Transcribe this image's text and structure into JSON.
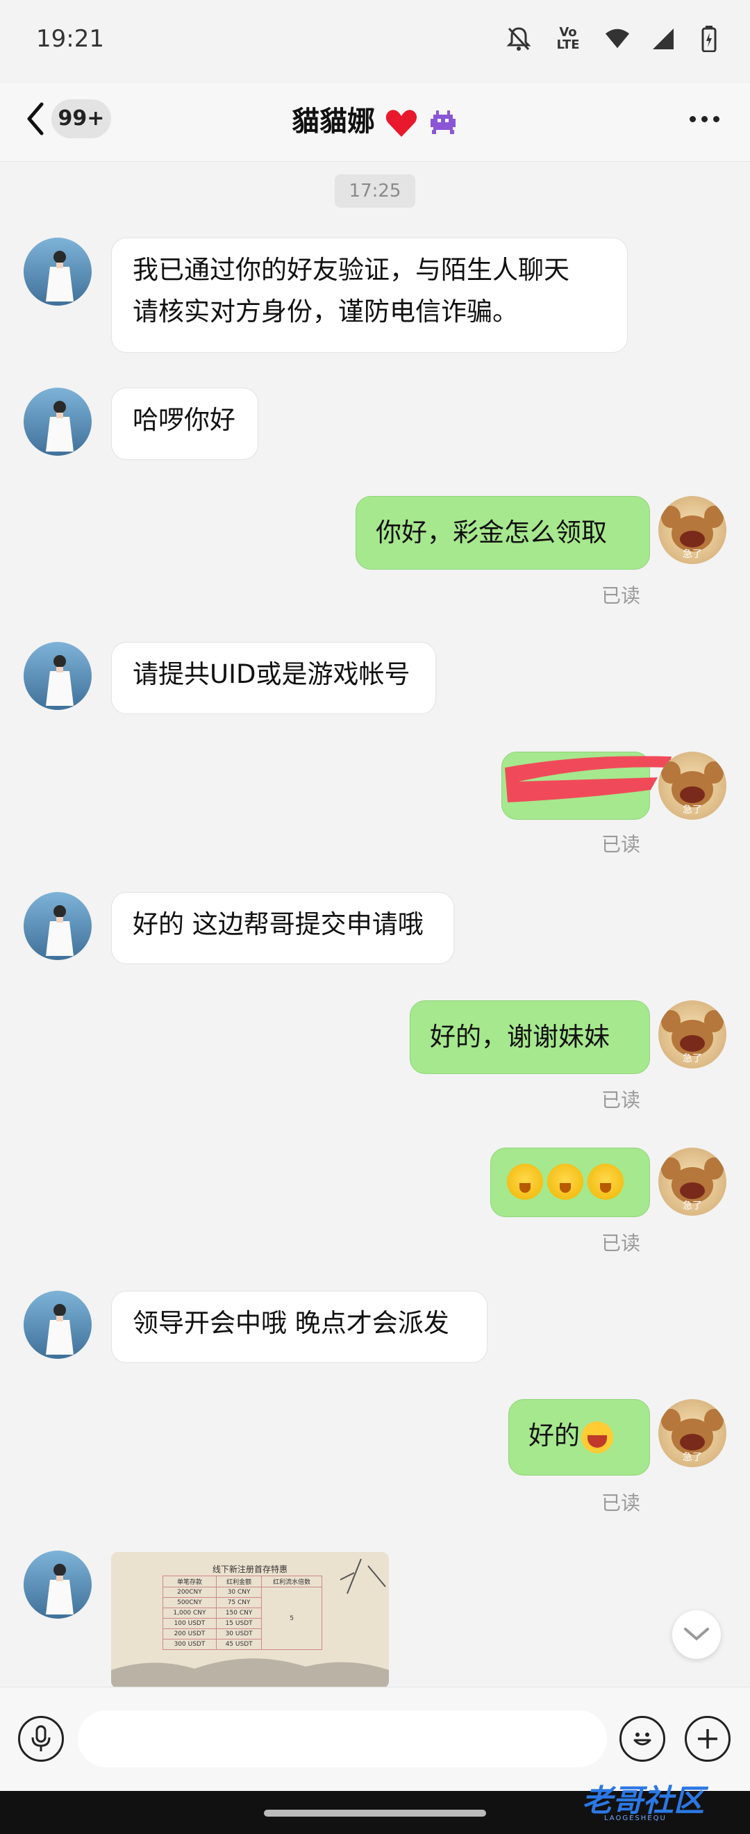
{
  "status_bar": {
    "time": "19:21",
    "volte": "Vo LTE"
  },
  "nav": {
    "unread_badge": "99+",
    "title": "貓貓娜"
  },
  "time_divider": "17:25",
  "messages": [
    {
      "side": "left",
      "lines": [
        "我已通过你的好友验证，与陌生人聊天",
        "请核实对方身份，谨防电信诈骗。"
      ]
    },
    {
      "side": "left",
      "text": "哈啰你好"
    },
    {
      "side": "right",
      "text": "你好，彩金怎么领取",
      "status": "已读"
    },
    {
      "side": "left",
      "text": "请提共UID或是游戏帐号"
    },
    {
      "side": "right",
      "text": "",
      "status": "已读",
      "redacted": true
    },
    {
      "side": "left",
      "text": "好的 这边帮哥提交申请哦"
    },
    {
      "side": "right",
      "text": "好的，谢谢妹妹",
      "status": "已读"
    },
    {
      "side": "right",
      "emoji": "flushed-faces",
      "status": "已读"
    },
    {
      "side": "left",
      "text": "领导开会中哦  晚点才会派发"
    },
    {
      "side": "right",
      "text": "好的",
      "emoji": "laughing-face",
      "status": "已读"
    }
  ],
  "image_card": {
    "title": "线下新注册首存特惠",
    "headers": [
      "单笔存款",
      "红利金额",
      "红利流水倍数"
    ],
    "rows": [
      [
        "200CNY",
        "30 CNY"
      ],
      [
        "500CNY",
        "75 CNY"
      ],
      [
        "1,000 CNY",
        "150 CNY"
      ],
      [
        "100 USDT",
        "15 USDT"
      ],
      [
        "200 USDT",
        "30 USDT"
      ],
      [
        "300 USDT",
        "45 USDT"
      ]
    ],
    "multiplier": "5"
  },
  "avatar_caption": "急了",
  "watermark": {
    "text": "老哥社区",
    "sub": "LAOGESHEQU"
  },
  "colors": {
    "bubble_right": "#a6e88d",
    "bubble_left": "#ffffff",
    "background": "#f3f3f3",
    "redaction": "#f04a5a"
  }
}
